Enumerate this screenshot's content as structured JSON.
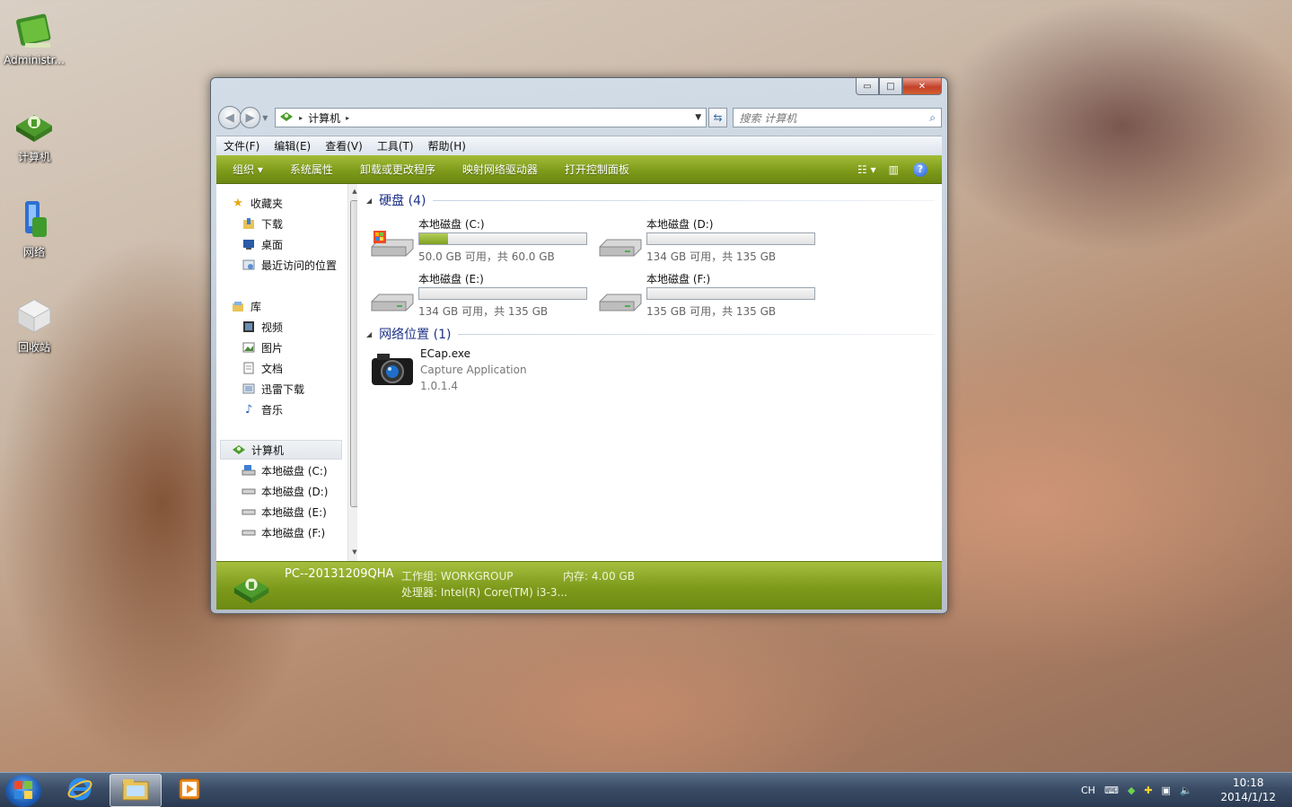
{
  "desktop": {
    "icons": [
      {
        "label": "Administr..."
      },
      {
        "label": "计算机"
      },
      {
        "label": "网络"
      },
      {
        "label": "回收站"
      }
    ]
  },
  "window": {
    "caption": {
      "min": "▭",
      "max": "□",
      "close": "✕"
    },
    "address": {
      "crumb": "计算机",
      "sep1": "▸",
      "sep2": "▸"
    },
    "search": {
      "placeholder": "搜索 计算机"
    },
    "menu": [
      "文件(F)",
      "编辑(E)",
      "查看(V)",
      "工具(T)",
      "帮助(H)"
    ],
    "toolbar": {
      "organize": "组织 ▾",
      "items": [
        "系统属性",
        "卸载或更改程序",
        "映射网络驱动器",
        "打开控制面板"
      ],
      "help": "?"
    },
    "nav": {
      "favorites": "收藏夹",
      "downloads": "下载",
      "desktop": "桌面",
      "recent": "最近访问的位置",
      "libraries": "库",
      "videos": "视频",
      "pictures": "图片",
      "documents": "文档",
      "xunlei": "迅雷下载",
      "music": "音乐",
      "computer": "计算机",
      "drive_c": "本地磁盘 (C:)",
      "drive_d": "本地磁盘 (D:)",
      "drive_e": "本地磁盘 (E:)",
      "drive_f": "本地磁盘 (F:)"
    },
    "groups": {
      "hdd": "硬盘 (4)",
      "network": "网络位置 (1)"
    },
    "drives": [
      {
        "name": "本地磁盘 (C:)",
        "free": "50.0 GB 可用，共 60.0 GB",
        "used_fraction": 0.17
      },
      {
        "name": "本地磁盘 (D:)",
        "free": "134 GB 可用，共 135 GB",
        "used_fraction": 0.0
      },
      {
        "name": "本地磁盘 (E:)",
        "free": "134 GB 可用，共 135 GB",
        "used_fraction": 0.0
      },
      {
        "name": "本地磁盘 (F:)",
        "free": "135 GB 可用，共 135 GB",
        "used_fraction": 0.0
      }
    ],
    "network_item": {
      "name": "ECap.exe",
      "desc": "Capture Application",
      "version": "1.0.1.4"
    },
    "details": {
      "pc_name": "PC--20131209QHA",
      "workgroup": "工作组: WORKGROUP",
      "memory": "内存: 4.00 GB",
      "cpu": "处理器: Intel(R) Core(TM) i3-3..."
    }
  },
  "taskbar": {
    "tray_lang": "CH",
    "time": "10:18",
    "date": "2014/1/12"
  }
}
